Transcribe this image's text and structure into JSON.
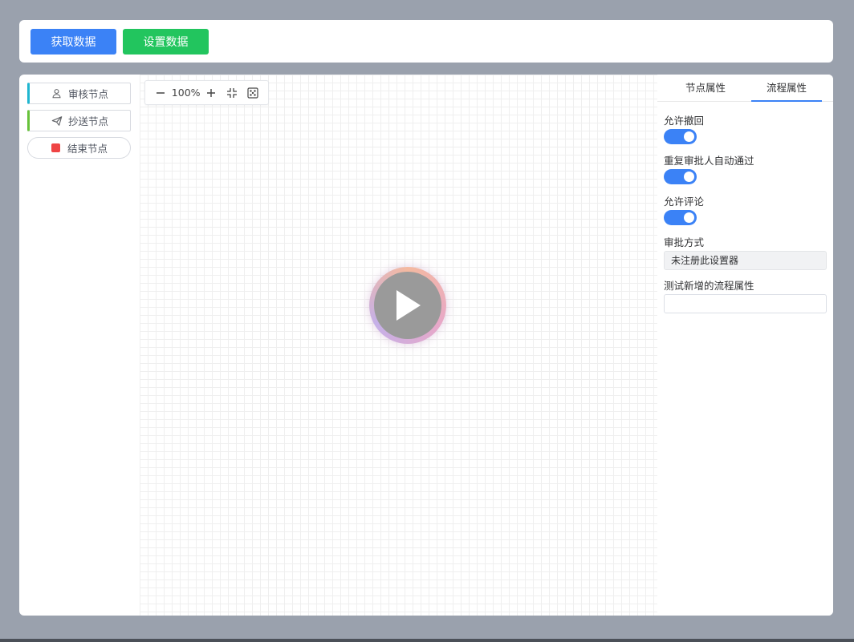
{
  "toolbar": {
    "get_data_label": "获取数据",
    "set_data_label": "设置数据"
  },
  "palette": {
    "items": [
      {
        "label": "审核节点",
        "icon": "user-icon"
      },
      {
        "label": "抄送节点",
        "icon": "send-icon"
      },
      {
        "label": "结束节点",
        "icon": "stop-square-icon"
      }
    ]
  },
  "zoom": {
    "level": "100%"
  },
  "panel": {
    "tabs": [
      {
        "label": "节点属性",
        "active": false
      },
      {
        "label": "流程属性",
        "active": true
      }
    ],
    "fields": {
      "allow_withdraw": {
        "label": "允许撤回",
        "value": true
      },
      "auto_pass_repeat": {
        "label": "重复审批人自动通过",
        "value": true
      },
      "allow_comment": {
        "label": "允许评论",
        "value": true
      },
      "approval_mode": {
        "label": "审批方式",
        "value": "未注册此设置器"
      },
      "test_flow_attr": {
        "label": "测试新增的流程属性",
        "value": ""
      }
    }
  },
  "colors": {
    "primary_blue": "#3b82f6",
    "success_green": "#22c55e",
    "audit_accent": "#1fb6d0",
    "cc_accent": "#67c23a",
    "end_red": "#ef4444"
  }
}
